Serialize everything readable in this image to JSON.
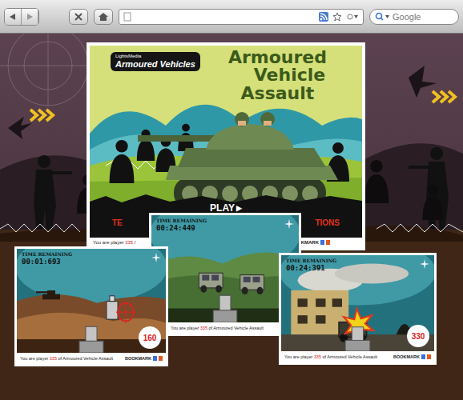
{
  "browser": {
    "search": {
      "placeholder": "Google"
    }
  },
  "main_panel": {
    "publisher": "LightsMedia",
    "logo": "Armoured Vehicles",
    "title": [
      "Armoured",
      "Vehicle",
      "Assault"
    ],
    "play": {
      "label": "PLAY",
      "icon": "▶"
    },
    "menu": [
      "TE",
      "TIONS"
    ],
    "footer": {
      "prefix": "You are player ",
      "number": "335",
      "suffix": " /"
    },
    "bookmark": "BOOKMARK"
  },
  "screenshots": [
    {
      "kind": "desert",
      "time_label": "TIME REMAINING",
      "time": "00:01:693",
      "score": "160",
      "footer": {
        "prefix": "You are player ",
        "number": "335",
        "suffix": " of Armoured Vehicle Assault"
      },
      "bookmark": "BOOKMARK"
    },
    {
      "kind": "hills",
      "time_label": "TIME REMAINING",
      "time": "00:24:449",
      "score": null,
      "footer": {
        "prefix": "You are player ",
        "number": "335",
        "suffix": " of Armoured Vehicle Assault"
      },
      "bookmark": null
    },
    {
      "kind": "town",
      "time_label": "TIME REMAINING",
      "time": "00:24:391",
      "score": "330",
      "footer": {
        "prefix": "You are player ",
        "number": "335",
        "suffix": " of Armoured Vehicle Assault"
      },
      "bookmark": "BOOKMARK"
    }
  ]
}
